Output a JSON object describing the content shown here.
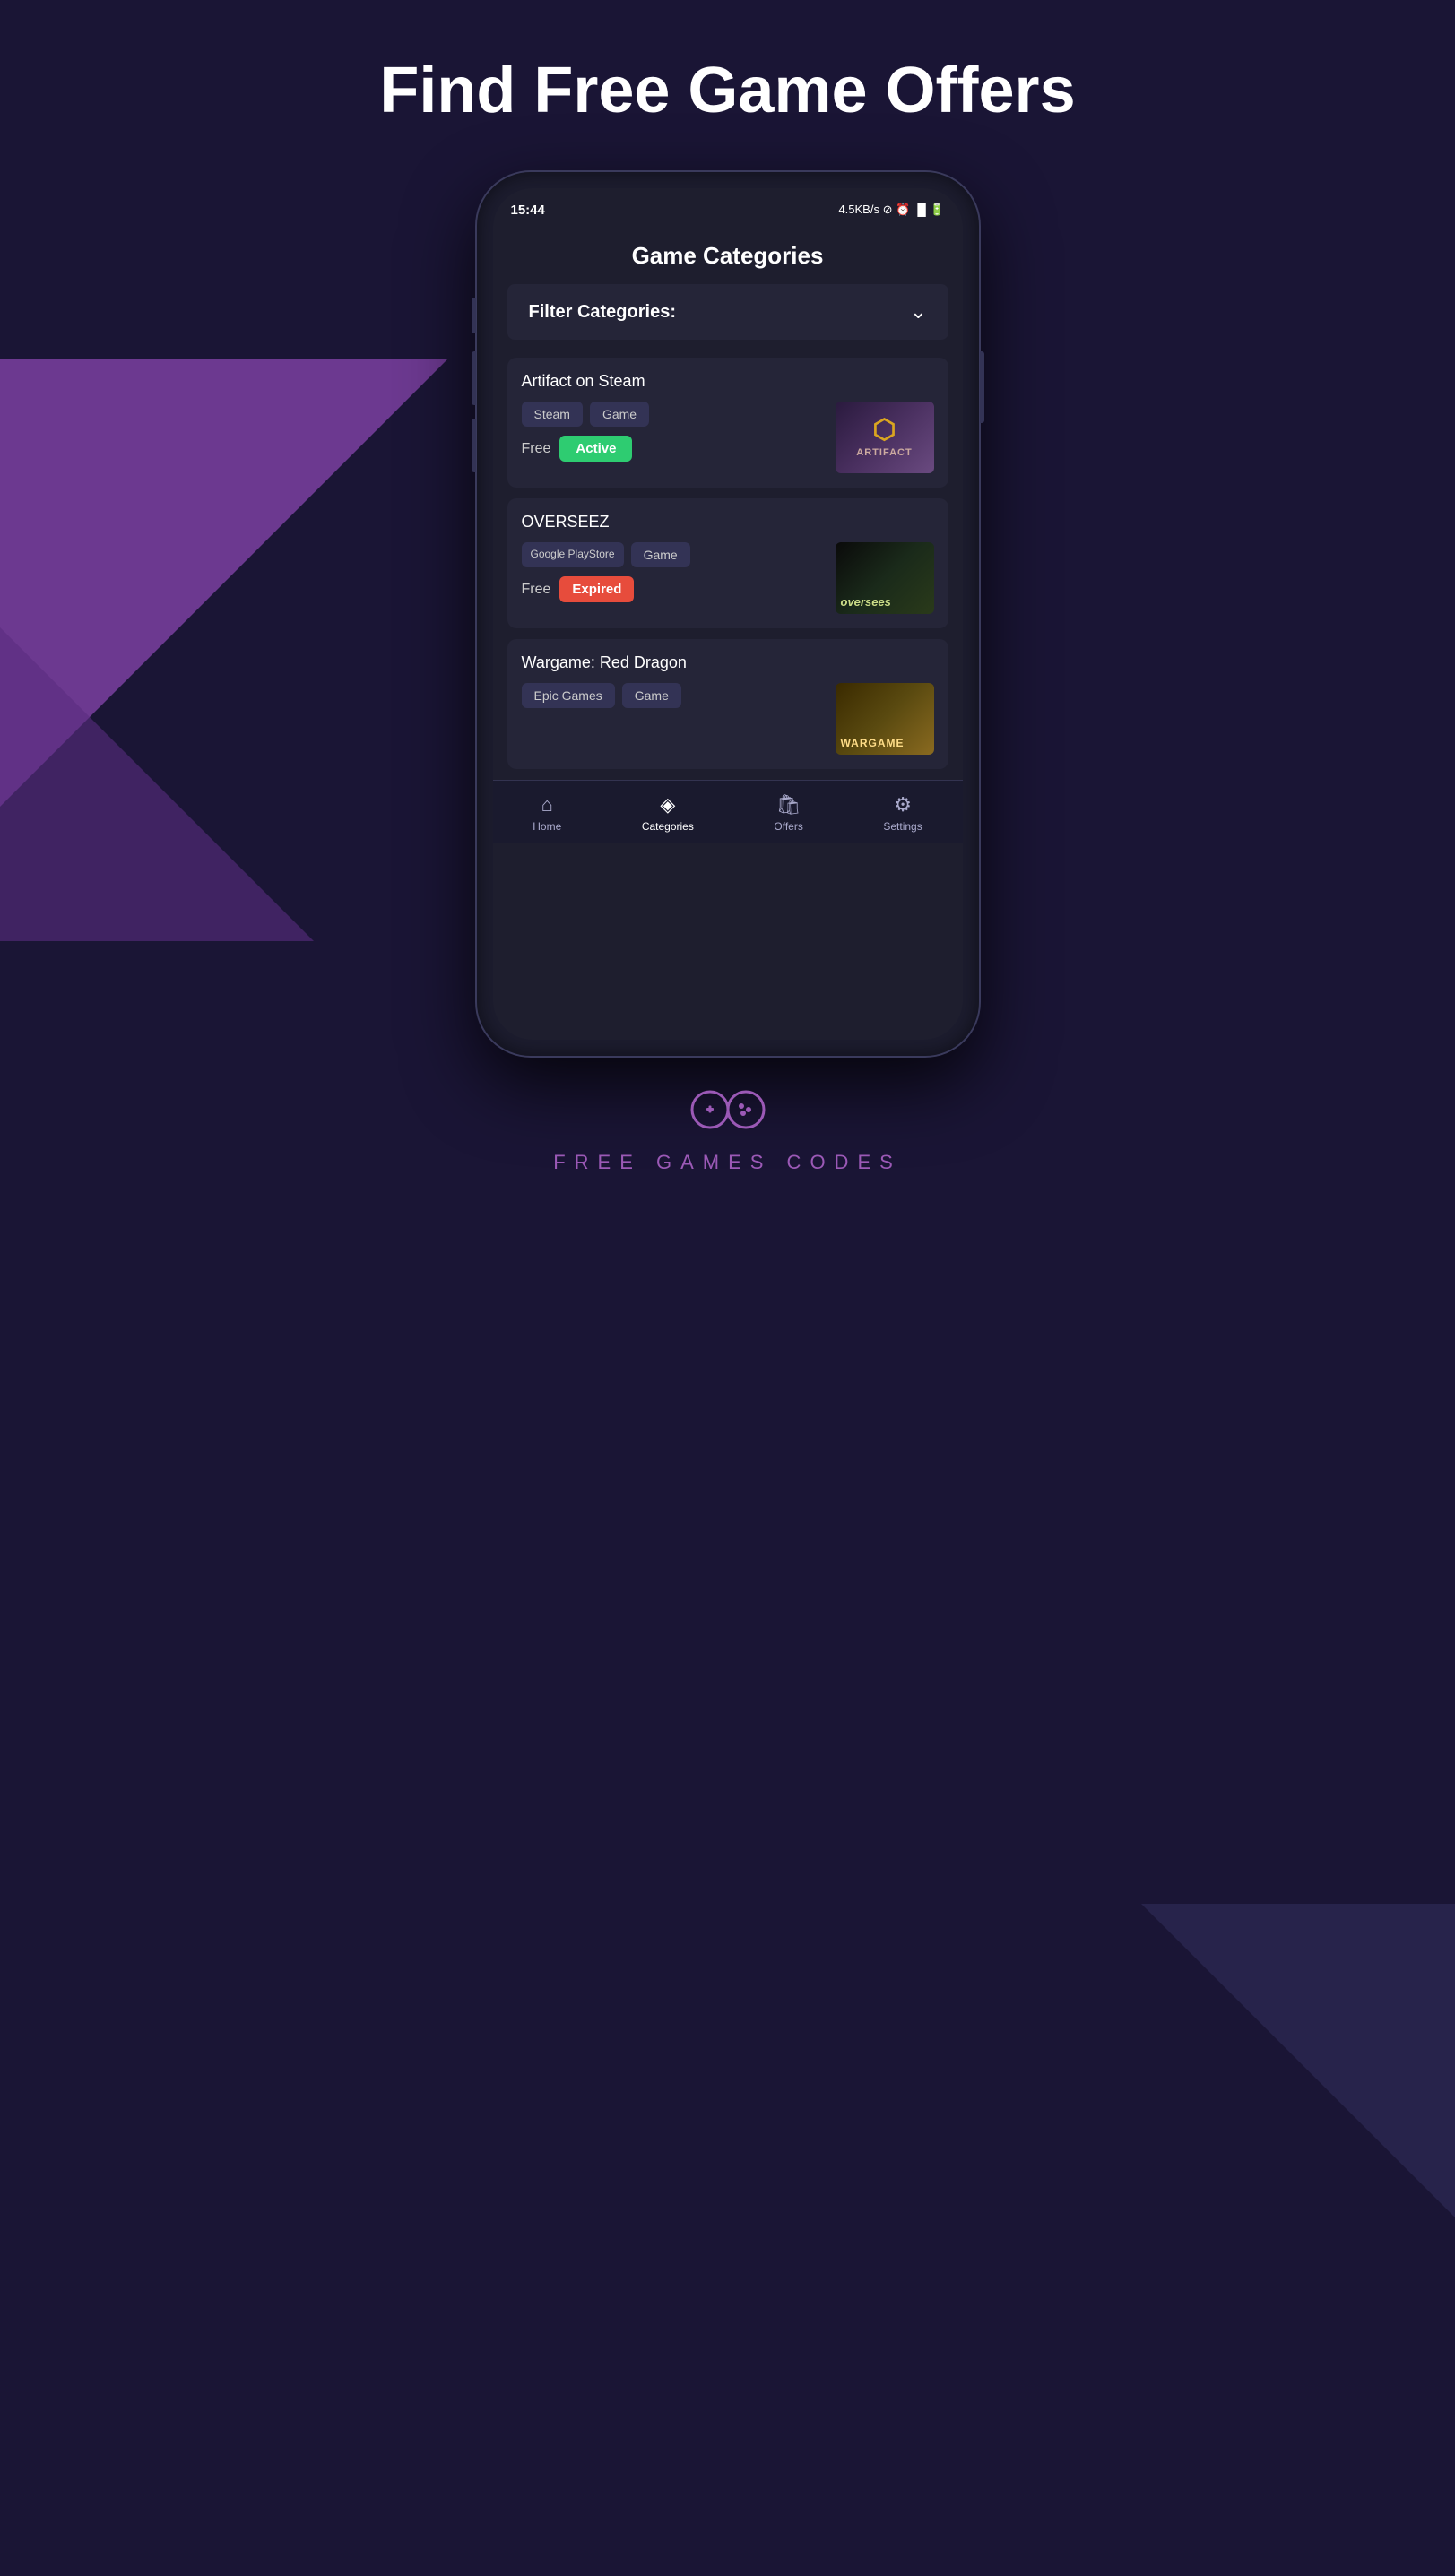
{
  "page": {
    "headline": "Find Free Game Offers"
  },
  "phone": {
    "time": "15:44",
    "status": "4.5KB/s ⊘ ⏰ 📶 🔋"
  },
  "app": {
    "title": "Game Categories",
    "filter_label": "Filter Categories:",
    "games": [
      {
        "id": "artifact",
        "title": "Artifact on Steam",
        "tags": [
          "Steam",
          "Game"
        ],
        "price": "Free",
        "status": "Active",
        "status_type": "active",
        "thumb_type": "artifact"
      },
      {
        "id": "overseez",
        "title": "OVERSEEZ",
        "tags": [
          "Google PlayStore",
          "Game"
        ],
        "price": "Free",
        "status": "Expired",
        "status_type": "expired",
        "thumb_type": "oversees"
      },
      {
        "id": "wargame",
        "title": "Wargame: Red Dragon",
        "tags": [
          "Epic Games",
          "Game"
        ],
        "price": "",
        "status": "",
        "status_type": "",
        "thumb_type": "wargame"
      }
    ],
    "nav": [
      {
        "id": "home",
        "label": "Home",
        "icon": "🏠",
        "active": false
      },
      {
        "id": "categories",
        "label": "Categories",
        "icon": "◈",
        "active": true
      },
      {
        "id": "offers",
        "label": "Offers",
        "icon": "🛍",
        "active": false
      },
      {
        "id": "settings",
        "label": "Settings",
        "icon": "⚙",
        "active": false
      }
    ]
  },
  "brand": {
    "name": "FREE  GAMES  CODES"
  }
}
